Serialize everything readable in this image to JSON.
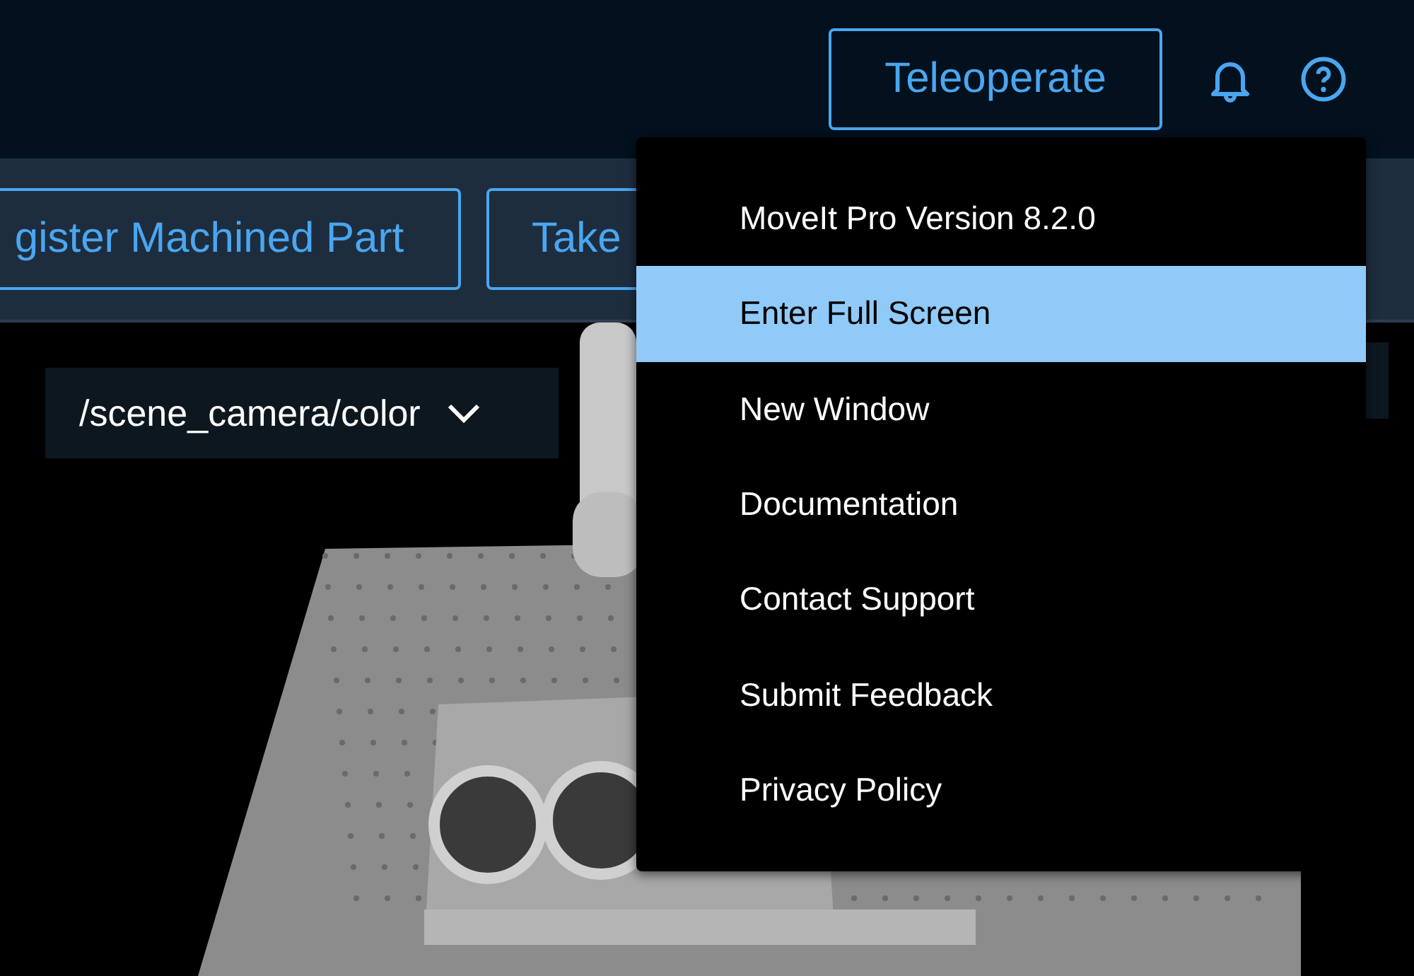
{
  "header": {
    "primary_button": "Teleoperate"
  },
  "toolbar": {
    "buttons": [
      "gister Machined Part",
      "Take"
    ]
  },
  "camera_view": {
    "topic_select": "/scene_camera/color"
  },
  "help_menu": {
    "items": [
      {
        "label": "MoveIt Pro Version 8.2.0",
        "selected": false
      },
      {
        "label": "Enter Full Screen",
        "selected": true
      },
      {
        "label": "New Window",
        "selected": false
      },
      {
        "label": "Documentation",
        "selected": false
      },
      {
        "label": "Contact Support",
        "selected": false
      },
      {
        "label": "Submit Feedback",
        "selected": false
      },
      {
        "label": "Privacy Policy",
        "selected": false
      }
    ]
  }
}
